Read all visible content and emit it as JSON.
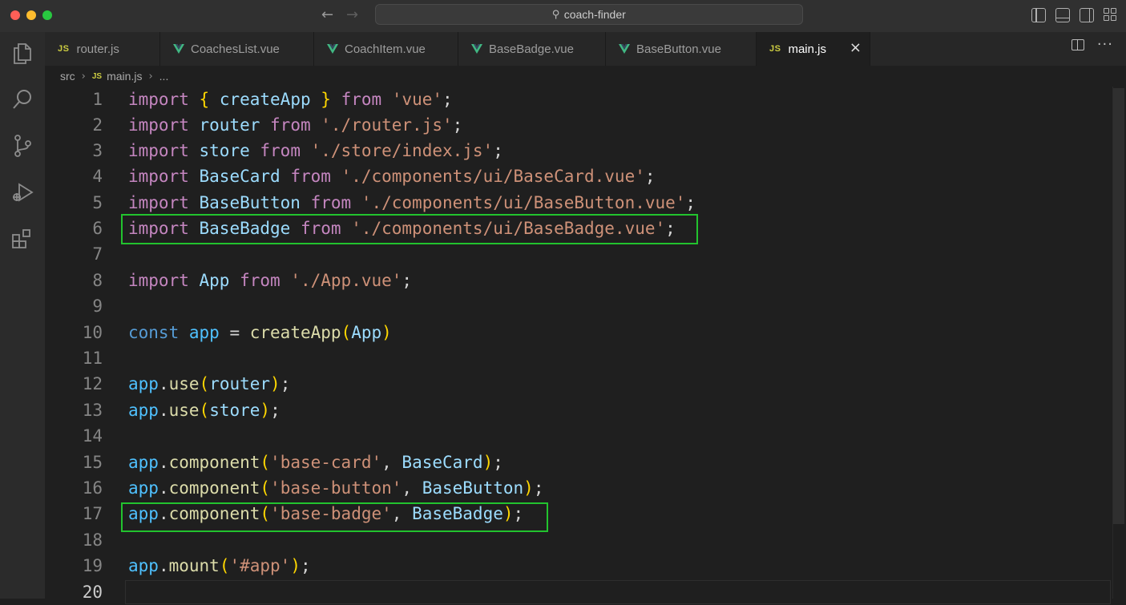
{
  "window": {
    "search_text": "coach-finder",
    "back_icon": "arrow-left-icon",
    "forward_icon": "arrow-right-icon"
  },
  "tabs": [
    {
      "label": "router.js",
      "type": "js",
      "active": false
    },
    {
      "label": "CoachesList.vue",
      "type": "vue",
      "active": false
    },
    {
      "label": "CoachItem.vue",
      "type": "vue",
      "active": false
    },
    {
      "label": "BaseBadge.vue",
      "type": "vue",
      "active": false
    },
    {
      "label": "BaseButton.vue",
      "type": "vue",
      "active": false
    },
    {
      "label": "main.js",
      "type": "js",
      "active": true
    }
  ],
  "file_badges": {
    "js": "JS"
  },
  "breadcrumb": {
    "folder": "src",
    "file": "main.js",
    "trail": "..."
  },
  "editor": {
    "current_line": 20,
    "line_numbers": [
      "1",
      "2",
      "3",
      "4",
      "5",
      "6",
      "7",
      "8",
      "9",
      "10",
      "11",
      "12",
      "13",
      "14",
      "15",
      "16",
      "17",
      "18",
      "19",
      "20"
    ],
    "lines": [
      "import { createApp } from 'vue';",
      "import router from './router.js';",
      "import store from './store/index.js';",
      "import BaseCard from './components/ui/BaseCard.vue';",
      "import BaseButton from './components/ui/BaseButton.vue';",
      "import BaseBadge from './components/ui/BaseBadge.vue';",
      "",
      "import App from './App.vue';",
      "",
      "const app = createApp(App)",
      "",
      "app.use(router);",
      "app.use(store);",
      "",
      "app.component('base-card', BaseCard);",
      "app.component('base-button', BaseButton);",
      "app.component('base-badge', BaseBadge);",
      "",
      "app.mount('#app');",
      ""
    ],
    "highlighted_lines": [
      6,
      17
    ],
    "highlight_color": "#22c32e"
  },
  "colors": {
    "keyword": "#c586c0",
    "storage": "#569cd6",
    "variable": "#9cdcfe",
    "function": "#dcdcaa",
    "string": "#ce9178",
    "bracket": "#ffd700",
    "vue_green": "#41b883",
    "js_yellow": "#cbcb41"
  },
  "activity_bar": [
    {
      "name": "explorer-icon"
    },
    {
      "name": "search-icon"
    },
    {
      "name": "source-control-icon"
    },
    {
      "name": "run-debug-icon"
    },
    {
      "name": "extensions-icon"
    }
  ]
}
